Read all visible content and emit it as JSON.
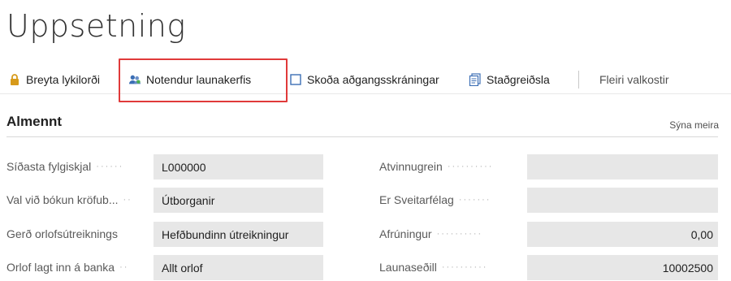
{
  "page": {
    "title": "Uppsetning"
  },
  "actions": {
    "change_password": "Breyta lykilorði",
    "payroll_users": "Notendur launakerfis",
    "view_access_log": "Skoða aðgangsskráningar",
    "confirmation": "Staðgreiðsla",
    "more_options": "Fleiri valkostir"
  },
  "section": {
    "title": "Almennt",
    "show_more": "Sýna meira"
  },
  "fields": {
    "left": [
      {
        "label": "Síðasta fylgiskjal",
        "value": "L000000"
      },
      {
        "label": "Val við bókun kröfub...",
        "value": "Útborganir"
      },
      {
        "label": "Gerð orlofsútreiknings",
        "value": "Hefðbundinn útreikningur"
      },
      {
        "label": "Orlof lagt inn á banka",
        "value": "Allt orlof"
      }
    ],
    "right": [
      {
        "label": "Atvinnugrein",
        "value": ""
      },
      {
        "label": "Er Sveitarfélag",
        "value": ""
      },
      {
        "label": "Afrúningur",
        "value": "0,00"
      },
      {
        "label": "Launaseðill",
        "value": "10002500"
      }
    ]
  },
  "colors": {
    "highlight": "#e03a3a",
    "field_bg": "#e7e7e7",
    "lock_icon": "#d79a1a",
    "users_icon": "#3c6fb5",
    "doc_icon": "#3c6fb5"
  }
}
